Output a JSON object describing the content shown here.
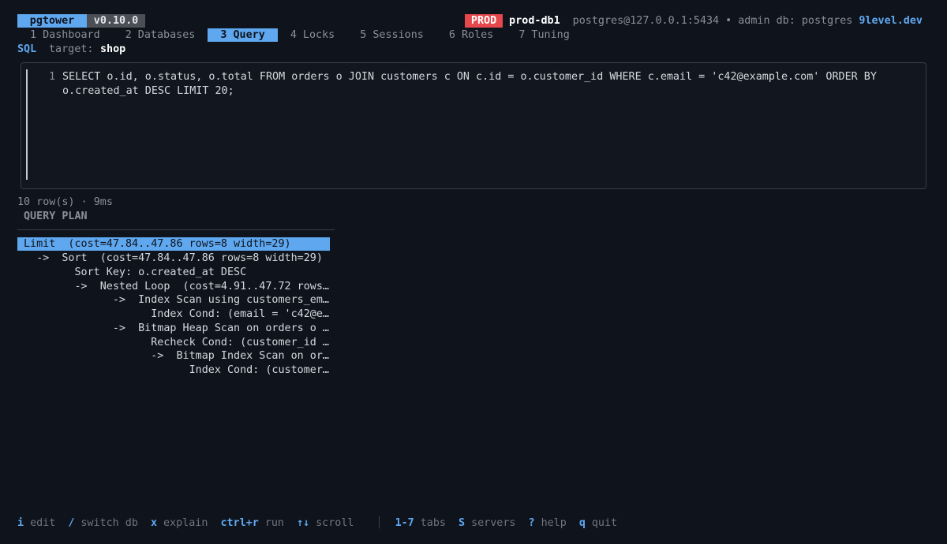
{
  "app": {
    "name": "pgtower",
    "version": "v0.10.0"
  },
  "header": {
    "env_badge": "PROD",
    "server_name": "prod-db1",
    "connection": "postgres@127.0.0.1:5434 • admin db: postgres",
    "brand": "9level.dev"
  },
  "tabs": [
    {
      "label": "1 Dashboard"
    },
    {
      "label": "2 Databases"
    },
    {
      "label": "3 Query",
      "active": true
    },
    {
      "label": "4 Locks"
    },
    {
      "label": "5 Sessions"
    },
    {
      "label": "6 Roles"
    },
    {
      "label": "7 Tuning"
    }
  ],
  "query": {
    "mode_label": "SQL",
    "target_label": "target:",
    "target_db": "shop",
    "line_number": "1",
    "sql_line1": "SELECT o.id, o.status, o.total FROM orders o JOIN customers c ON c.id = o.customer_id WHERE c.email = 'c42@example.com' ORDER BY",
    "sql_line2": "o.created_at DESC LIMIT 20;"
  },
  "result": {
    "status": "10 row(s) · 9ms",
    "plan_header": "QUERY PLAN",
    "plan_rows": [
      "Limit  (cost=47.84..47.86 rows=8 width=29)",
      "  ->  Sort  (cost=47.84..47.86 rows=8 width=29)",
      "        Sort Key: o.created_at DESC",
      "        ->  Nested Loop  (cost=4.91..47.72 rows…",
      "              ->  Index Scan using customers_em…",
      "                    Index Cond: (email = 'c42@e…",
      "              ->  Bitmap Heap Scan on orders o …",
      "                    Recheck Cond: (customer_id …",
      "                    ->  Bitmap Index Scan on or…",
      "                          Index Cond: (customer…"
    ]
  },
  "footer": {
    "left": [
      {
        "key": "i",
        "desc": "edit"
      },
      {
        "key": "/",
        "desc": "switch db"
      },
      {
        "key": "x",
        "desc": "explain"
      },
      {
        "key": "ctrl+r",
        "desc": "run"
      },
      {
        "key": "↑↓",
        "desc": "scroll"
      }
    ],
    "separator": "│",
    "right": [
      {
        "key": "1-7",
        "desc": "tabs"
      },
      {
        "key": "S",
        "desc": "servers"
      },
      {
        "key": "?",
        "desc": "help"
      },
      {
        "key": "q",
        "desc": "quit"
      }
    ]
  }
}
